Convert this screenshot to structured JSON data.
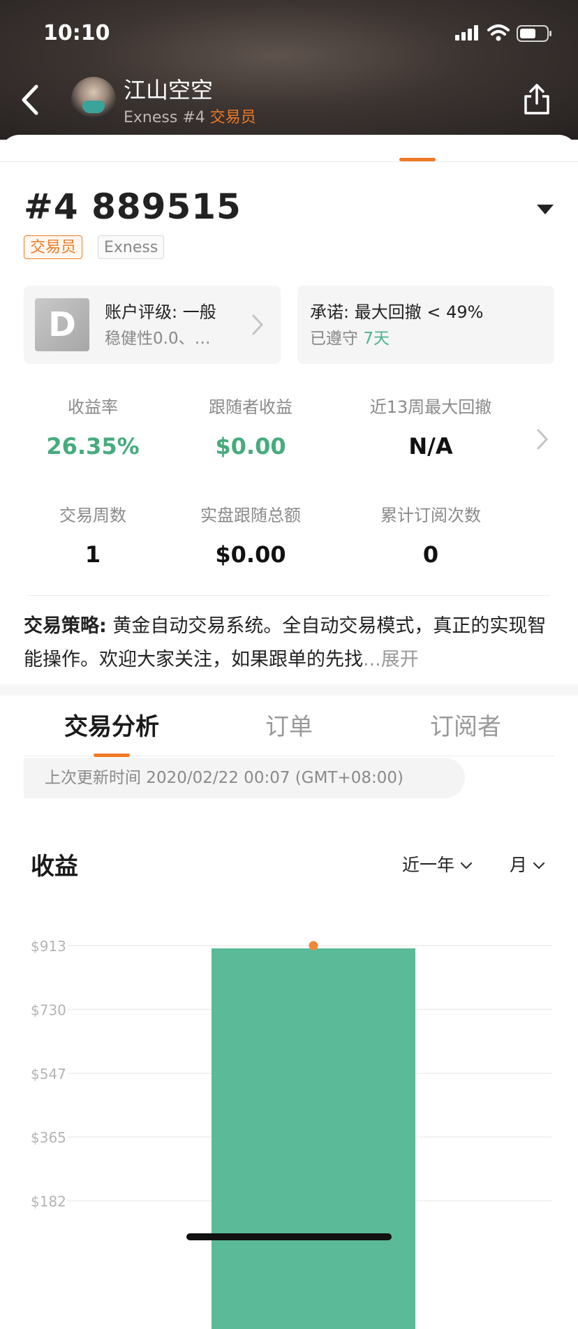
{
  "status_bar": {
    "time": "10:10"
  },
  "header": {
    "name": "江山空空",
    "broker": "Exness",
    "rank": "#4",
    "role": "交易员"
  },
  "account": {
    "number": "#4 889515",
    "tags": [
      "交易员",
      "Exness"
    ]
  },
  "rating_card": {
    "grade": "D",
    "title": "账户评级: 一般",
    "subtitle": "稳健性0.0、…"
  },
  "promise_card": {
    "title": "承诺: 最大回撤 < 49%",
    "kept_label": "已遵守",
    "kept_days": "7天"
  },
  "stats": [
    {
      "label": "收益率",
      "value": "26.35%",
      "color": "#46ab7d"
    },
    {
      "label": "跟随者收益",
      "value": "$0.00",
      "color": "#46ab7d"
    },
    {
      "label": "近13周最大回撤",
      "value": "N/A",
      "color": "#111111"
    },
    {
      "label": "交易周数",
      "value": "1",
      "color": "#111111"
    },
    {
      "label": "实盘跟随总额",
      "value": "$0.00",
      "color": "#111111"
    },
    {
      "label": "累计订阅次数",
      "value": "0",
      "color": "#111111"
    }
  ],
  "strategy": {
    "label": "交易策略:",
    "text": " 黄金自动交易系统。全自动交易模式，真正的实现智能操作。欢迎大家关注，如果跟单的先找",
    "more": "...展开"
  },
  "tabs": [
    "交易分析",
    "订单",
    "订阅者"
  ],
  "update_time": "上次更新时间 2020/02/22 00:07 (GMT+08:00)",
  "chart_section": {
    "title": "收益",
    "range": "近一年",
    "period": "月"
  },
  "chart_data": {
    "type": "bar",
    "title": "收益",
    "y_tick_labels": [
      "$913",
      "$730",
      "$547",
      "$365",
      "$182"
    ],
    "y_ticks": [
      913,
      730,
      547,
      365,
      182
    ],
    "ylim": [
      0,
      913
    ],
    "bars": [
      {
        "value": 905
      }
    ],
    "marker_value": 913,
    "bar_color": "#5bba98",
    "marker_color": "#f0873a"
  }
}
